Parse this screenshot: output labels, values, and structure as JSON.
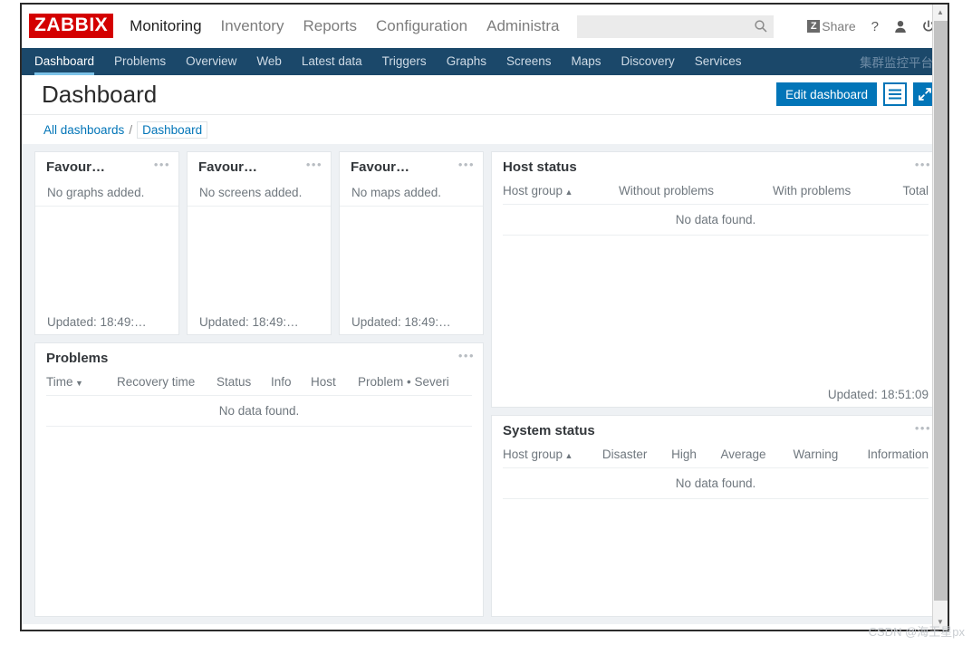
{
  "header": {
    "logo": "ZABBIX",
    "nav": [
      {
        "label": "Monitoring",
        "active": true
      },
      {
        "label": "Inventory",
        "active": false
      },
      {
        "label": "Reports",
        "active": false
      },
      {
        "label": "Configuration",
        "active": false
      },
      {
        "label": "Administra",
        "active": false
      }
    ],
    "search": {
      "value": "",
      "placeholder": "",
      "icon": "search-icon"
    },
    "share": {
      "badge": "Z",
      "label": "Share"
    },
    "icons": [
      {
        "name": "help-icon",
        "glyph": "?"
      },
      {
        "name": "user-profile-icon",
        "glyph": "὆4"
      },
      {
        "name": "power-signout-icon",
        "glyph": "⏻"
      }
    ]
  },
  "subnav": {
    "items": [
      {
        "label": "Dashboard",
        "active": true
      },
      {
        "label": "Problems",
        "active": false
      },
      {
        "label": "Overview",
        "active": false
      },
      {
        "label": "Web",
        "active": false
      },
      {
        "label": "Latest data",
        "active": false
      },
      {
        "label": "Triggers",
        "active": false
      },
      {
        "label": "Graphs",
        "active": false
      },
      {
        "label": "Screens",
        "active": false
      },
      {
        "label": "Maps",
        "active": false
      },
      {
        "label": "Discovery",
        "active": false
      },
      {
        "label": "Services",
        "active": false
      }
    ],
    "brand": "集群监控平台"
  },
  "page": {
    "title": "Dashboard",
    "edit_button": "Edit dashboard",
    "kiosk_menu_icon": "hamburger-menu-icon",
    "fullscreen_icon": "expand-arrows-icon"
  },
  "breadcrumb": {
    "all": "All dashboards",
    "separator": "/",
    "current": "Dashboard"
  },
  "widgets": {
    "fav_graphs": {
      "title": "Favour…",
      "empty": "No graphs added.",
      "updated": "Updated: 18:49:…",
      "menu": "•••"
    },
    "fav_screens": {
      "title": "Favour…",
      "empty": "No screens added.",
      "updated": "Updated: 18:49:…",
      "menu": "•••"
    },
    "fav_maps": {
      "title": "Favour…",
      "empty": "No maps added.",
      "updated": "Updated: 18:49:…",
      "menu": "•••"
    },
    "problems": {
      "title": "Problems",
      "menu": "•••",
      "columns": [
        {
          "label": "Time",
          "sort": "desc"
        },
        {
          "label": "Recovery time",
          "sort": null
        },
        {
          "label": "Status",
          "sort": null
        },
        {
          "label": "Info",
          "sort": null
        },
        {
          "label": "Host",
          "sort": null
        },
        {
          "label": "Problem • Severi",
          "sort": null
        }
      ],
      "no_data": "No data found."
    },
    "host_status": {
      "title": "Host status",
      "menu": "•••",
      "columns": [
        {
          "label": "Host group",
          "sort": "asc"
        },
        {
          "label": "Without problems",
          "sort": null
        },
        {
          "label": "With problems",
          "sort": null
        },
        {
          "label": "Total",
          "sort": null
        }
      ],
      "no_data": "No data found.",
      "updated": "Updated: 18:51:09"
    },
    "system_status": {
      "title": "System status",
      "menu": "•••",
      "columns": [
        {
          "label": "Host group",
          "sort": "asc"
        },
        {
          "label": "Disaster",
          "sort": null
        },
        {
          "label": "High",
          "sort": null
        },
        {
          "label": "Average",
          "sort": null
        },
        {
          "label": "Warning",
          "sort": null
        },
        {
          "label": "Information",
          "sort": null
        }
      ],
      "no_data": "No data found."
    }
  },
  "watermark": "CSDN @海王星px",
  "colors": {
    "brand_red": "#d40000",
    "nav_blue": "#1b486a",
    "accent_blue": "#0275b8",
    "active_underline": "#7cc2e8",
    "page_bg": "#eef1f4"
  }
}
